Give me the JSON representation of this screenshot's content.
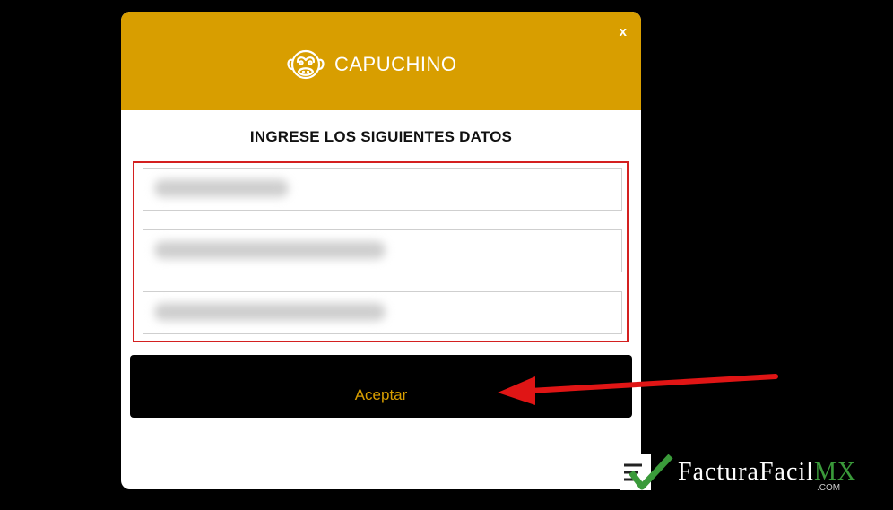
{
  "modal": {
    "close_label": "x",
    "brand_name": "CAPUCHINO",
    "title": "INGRESE LOS SIGUIENTES DATOS",
    "fields": [
      {
        "value": "",
        "blurred": true
      },
      {
        "value": "",
        "blurred": true
      },
      {
        "value": "",
        "blurred": true
      }
    ],
    "accept_label": "Aceptar"
  },
  "watermark": {
    "text": "FacturaFacil",
    "suffix": "MX",
    "domain": ".COM"
  },
  "colors": {
    "header": "#d89e00",
    "accent_text": "#d89e00",
    "highlight": "#d42020",
    "watermark_green": "#3a9a3a"
  }
}
